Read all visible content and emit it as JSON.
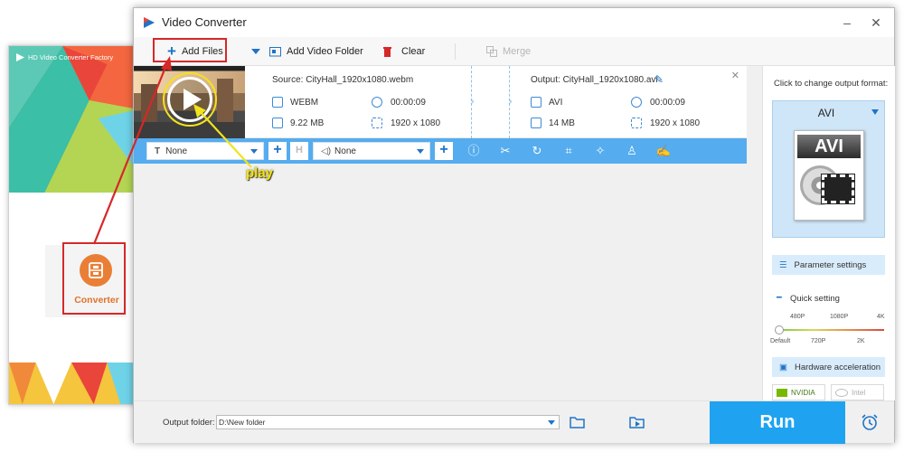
{
  "launcher": {
    "title": "HD Video Converter Factory",
    "converter_label": "Converter"
  },
  "window": {
    "title": "Video Converter",
    "minimize": "–",
    "close": "✕"
  },
  "toolbar": {
    "add_files": "Add Files",
    "add_video_folder": "Add Video Folder",
    "clear": "Clear",
    "merge": "Merge"
  },
  "file": {
    "source": "Source: CityHall_1920x1080.webm",
    "output": "Output: CityHall_1920x1080.avi",
    "src_format": "WEBM",
    "src_duration": "00:00:09",
    "src_size": "9.22 MB",
    "src_resolution": "1920 x 1080",
    "out_format": "AVI",
    "out_duration": "00:00:09",
    "out_size": "14 MB",
    "out_resolution": "1920 x 1080"
  },
  "edit_bar": {
    "subtitle_value": "None",
    "audio_value": "None"
  },
  "right_panel": {
    "title": "Click to change output format:",
    "format": "AVI",
    "format_card_text": "AVI",
    "parameter_settings": "Parameter settings",
    "quick_setting": "Quick setting",
    "ticks_top": [
      "480P",
      "1080P",
      "4K"
    ],
    "ticks_bottom": [
      "Default",
      "720P",
      "2K"
    ],
    "quality_level": 0,
    "hardware_acceleration": "Hardware acceleration",
    "nvidia": "NVIDIA",
    "intel": "Intel"
  },
  "bottom": {
    "output_folder_label": "Output folder:",
    "output_folder_value": "D:\\New folder",
    "run": "Run"
  },
  "annotations": {
    "play_label": "play"
  },
  "colors": {
    "accent_blue": "#55acee",
    "run_blue": "#1fa3f0",
    "highlight_red": "#d62828",
    "annotation_yellow": "#f1e31c",
    "converter_orange": "#e97f36"
  }
}
